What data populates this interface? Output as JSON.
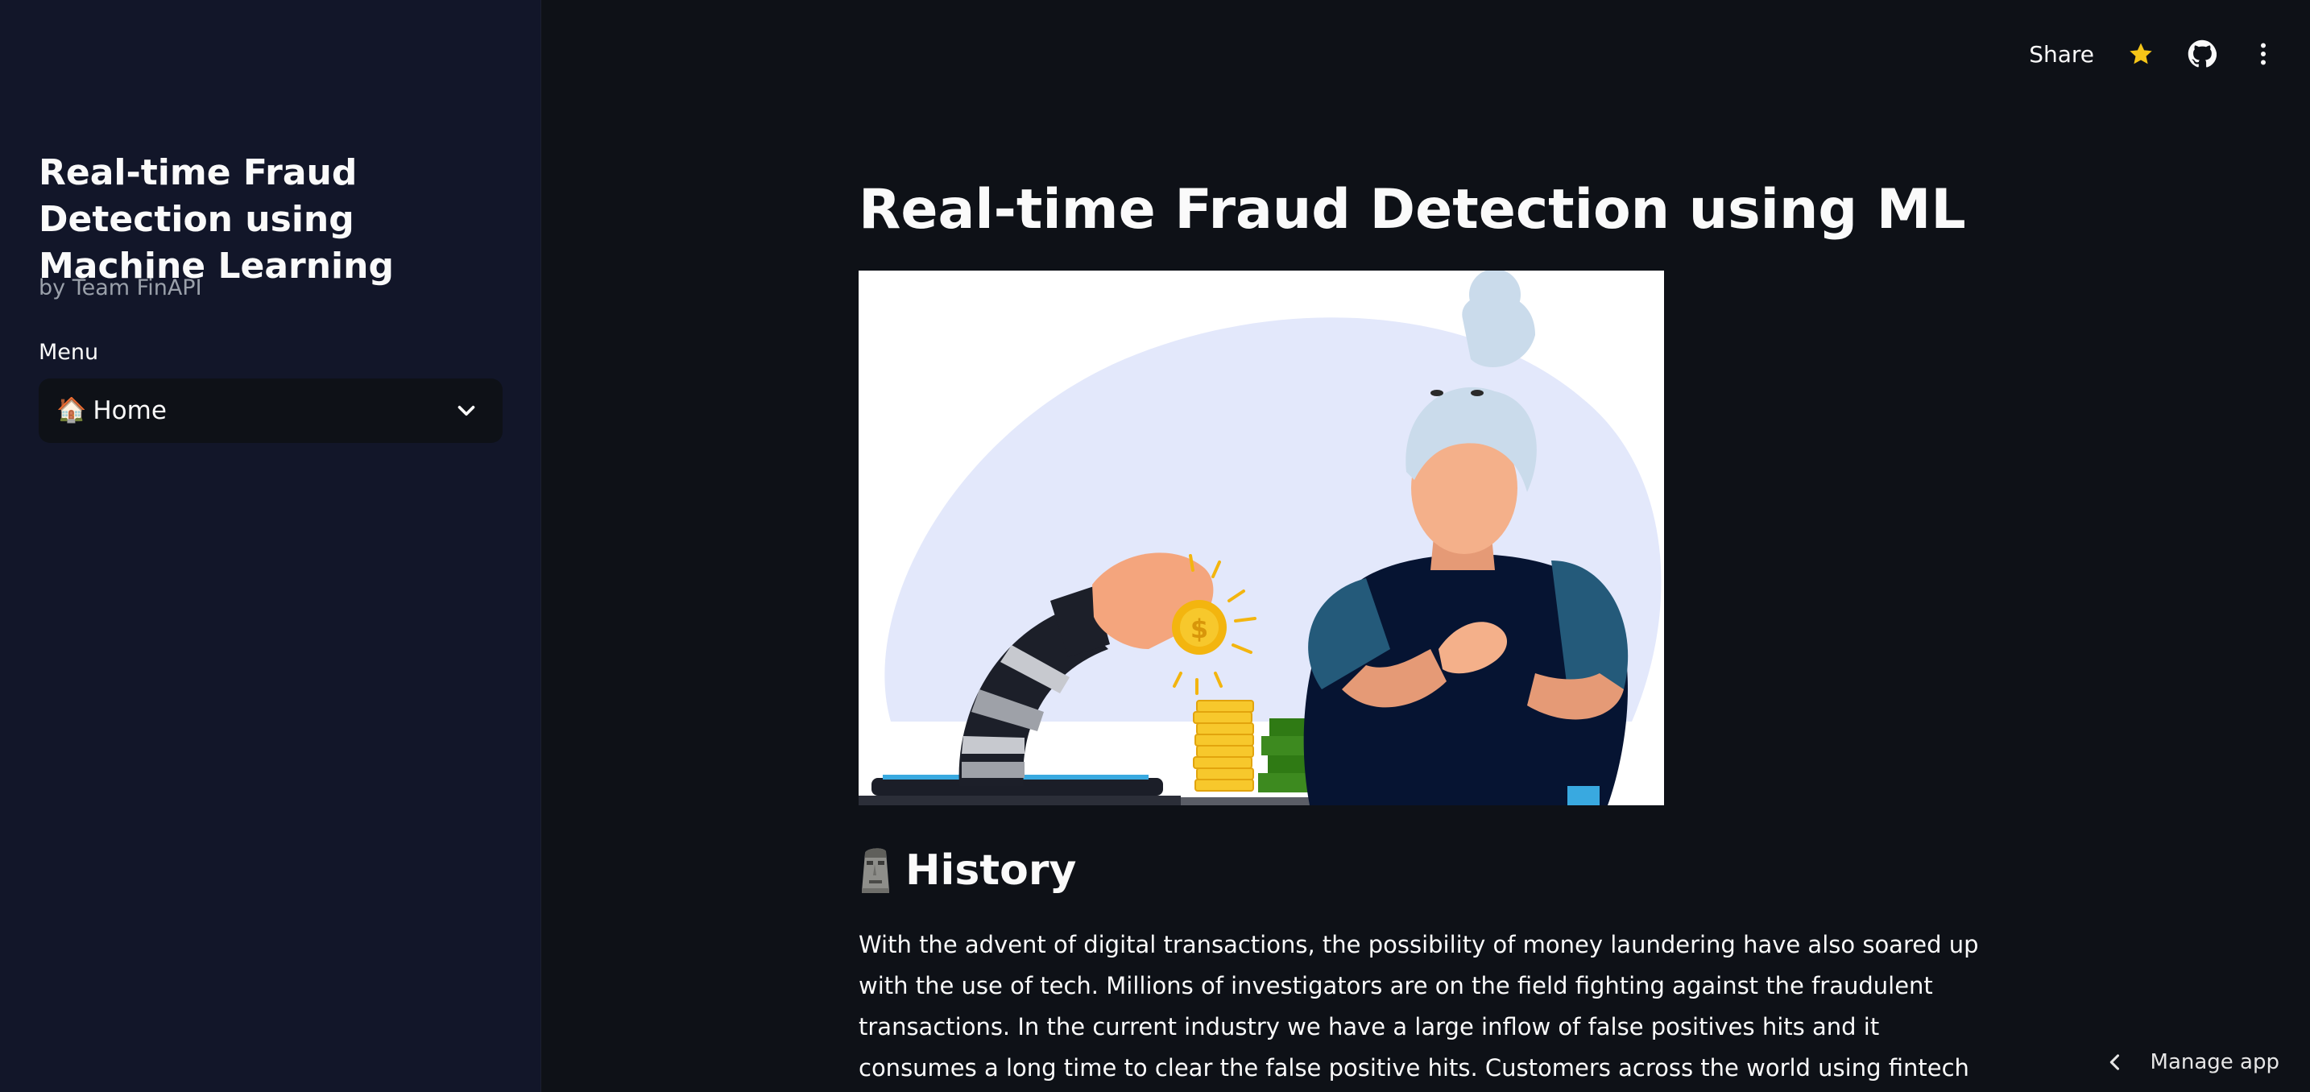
{
  "sidebar": {
    "title": "Real-time Fraud Detection using Machine Learning",
    "byline": "by Team FinAPI",
    "menu_label": "Menu",
    "menu_select": {
      "icon": "house-emoji",
      "value": "Home"
    }
  },
  "toolbar": {
    "share_label": "Share",
    "icons": [
      "star-icon",
      "github-icon",
      "kebab-menu-icon"
    ]
  },
  "main": {
    "title": "Real-time Fraud Detection using ML",
    "hero_image": "fraud-illustration",
    "history_icon": "moai-emoji",
    "history_heading": "History",
    "history_paragraph": "With the advent of digital transactions, the possibility of money laundering have also soared up with the use of tech. Millions of investigators are on the field fighting against the fraudulent transactions. In the current industry we have a large inflow of false positives hits and it consumes a long time to clear the false positive hits. Customers across the world using fintech platforms demand lightning fast services. Hence"
  },
  "footer": {
    "manage_label": "Manage app"
  },
  "colors": {
    "app_bg": "#0e1117",
    "sidebar_bg": "#121629",
    "star": "#f5c518",
    "text": "#fafafa"
  }
}
